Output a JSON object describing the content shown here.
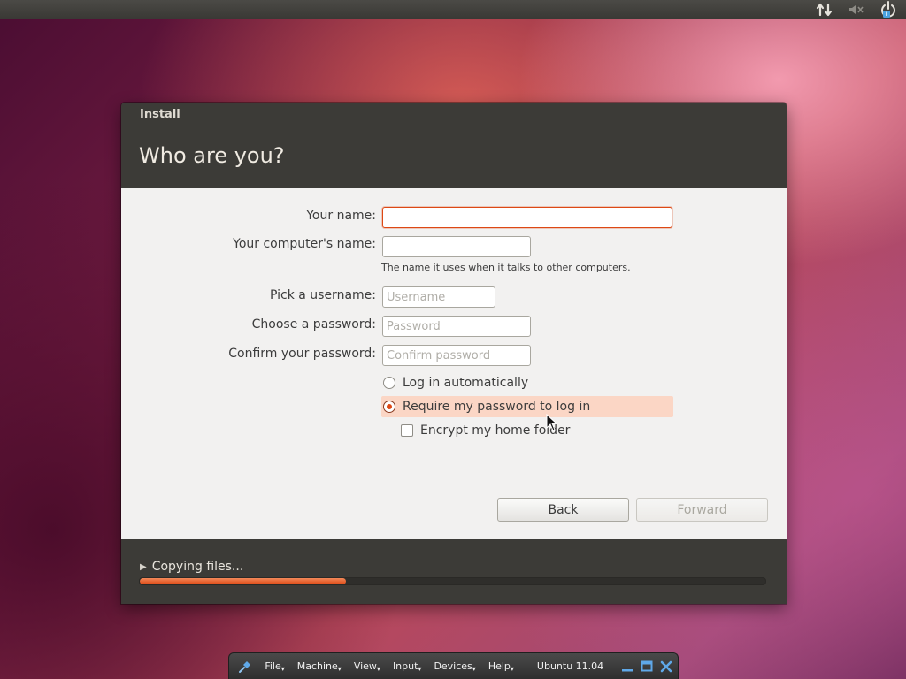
{
  "window": {
    "title": "Install",
    "heading": "Who are you?"
  },
  "form": {
    "name_label": "Your name:",
    "name_value": "",
    "computer_label": "Your computer's name:",
    "computer_value": "",
    "computer_hint": "The name it uses when it talks to other computers.",
    "username_label": "Pick a username:",
    "username_placeholder": "Username",
    "password_label": "Choose a password:",
    "password_placeholder": "Password",
    "confirm_label": "Confirm your password:",
    "confirm_placeholder": "Confirm password",
    "login_auto_label": "Log in automatically",
    "login_auto_checked": false,
    "require_password_label": "Require my password to log in",
    "require_password_checked": true,
    "encrypt_label": "Encrypt my home folder",
    "encrypt_checked": false
  },
  "buttons": {
    "back": "Back",
    "forward": "Forward"
  },
  "progress": {
    "status": "Copying files...",
    "percent": 33
  },
  "vbox": {
    "menus": [
      "File",
      "Machine",
      "View",
      "Input",
      "Devices",
      "Help"
    ],
    "vm_name": "Ubuntu 11.04"
  },
  "colors": {
    "accent": "#dd4814",
    "panel": "#3c3b37",
    "content_bg": "#f2f1f0"
  }
}
